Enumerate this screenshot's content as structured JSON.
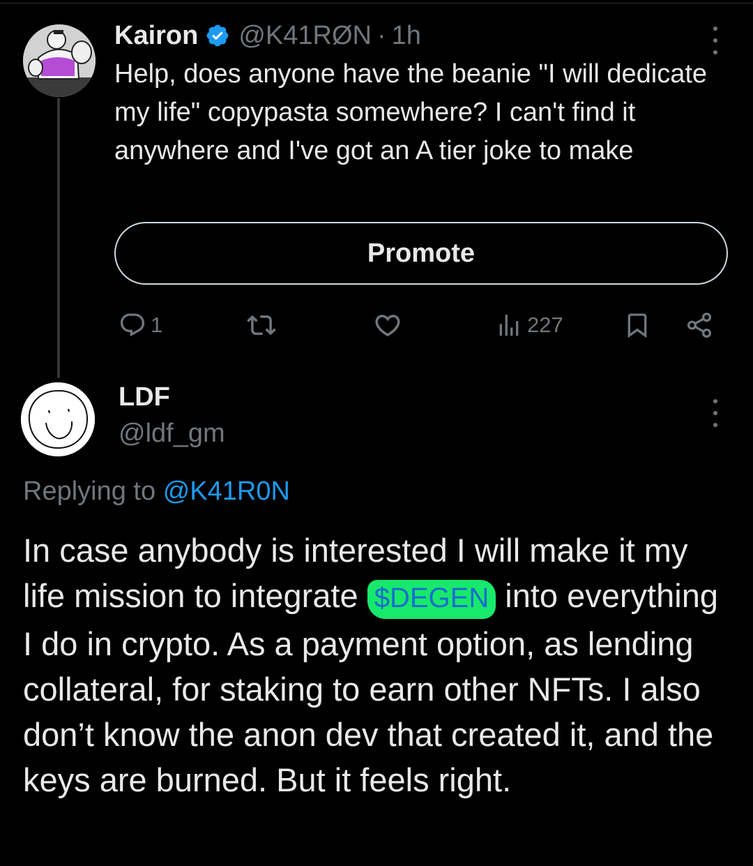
{
  "tweet1": {
    "author_name": "Kairon",
    "handle": "@K41RØN",
    "separator": "·",
    "time": "1h",
    "text": "Help, does anyone have the beanie \"I will dedicate my life\" copypasta somewhere? I can't find it anywhere and I've got an A tier joke to make",
    "promote_label": "Promote",
    "actions": {
      "replies": "1",
      "views": "227"
    }
  },
  "tweet2": {
    "author_name": "LDF",
    "handle": "@ldf_gm",
    "replying_prefix": "Replying to",
    "replying_handle": "@K41R0N",
    "text_before": "In case anybody is interested I will make it my life mission to integrate ",
    "cashtag": "$DEGEN",
    "text_after": " into everything I do in crypto. As a payment option, as lending collateral, for staking to earn other NFTs. I also don’t know the anon dev that created it, and the keys are burned. But it feels right."
  },
  "colors": {
    "background": "#000000",
    "primary_text": "#e7e9ea",
    "secondary_text": "#71767b",
    "link": "#1d9bf0",
    "highlight": "#18e86b"
  },
  "icons": {
    "verified": "verified-badge-icon",
    "more": "more-options-icon",
    "reply": "reply-icon",
    "retweet": "retweet-icon",
    "like": "heart-icon",
    "views": "views-icon",
    "bookmark": "bookmark-icon",
    "share": "share-icon"
  }
}
